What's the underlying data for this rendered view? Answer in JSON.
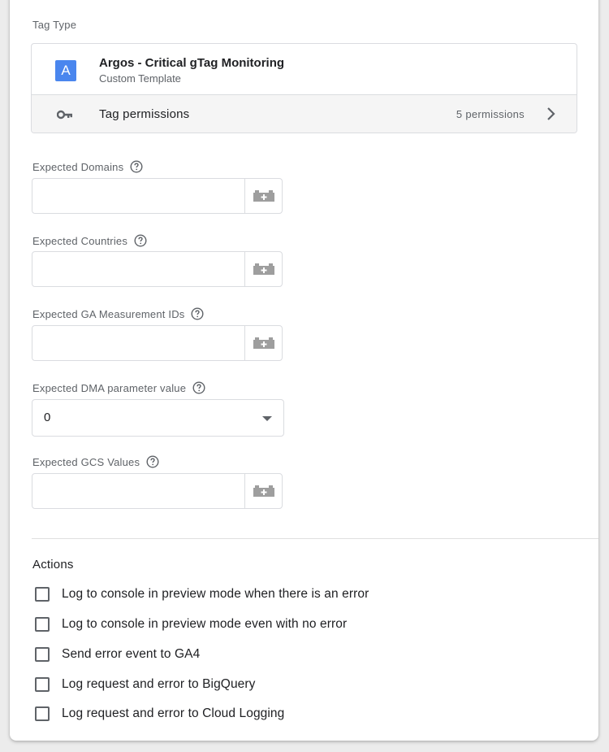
{
  "tag_type": {
    "section_label": "Tag Type",
    "avatar_letter": "A",
    "name": "Argos - Critical gTag Monitoring",
    "subtitle": "Custom Template",
    "permissions_label": "Tag permissions",
    "permissions_count": "5 permissions",
    "accent_color": "#4a86ee"
  },
  "fields": {
    "expected_domains": {
      "label": "Expected Domains",
      "value": ""
    },
    "expected_countries": {
      "label": "Expected Countries",
      "value": ""
    },
    "expected_ga_ids": {
      "label": "Expected GA Measurement IDs",
      "value": ""
    },
    "expected_dma": {
      "label": "Expected DMA parameter value",
      "selected": "0"
    },
    "expected_gcs": {
      "label": "Expected GCS Values",
      "value": ""
    }
  },
  "actions": {
    "title": "Actions",
    "items": [
      {
        "label": "Log to console in preview mode when there is an error",
        "checked": false
      },
      {
        "label": "Log to console in preview mode even with no error",
        "checked": false
      },
      {
        "label": "Send error event to GA4",
        "checked": false
      },
      {
        "label": "Log request and error to BigQuery",
        "checked": false
      },
      {
        "label": "Log request and error to Cloud Logging",
        "checked": false
      }
    ]
  },
  "icons": {
    "avatar": "letter-avatar",
    "permissions": "key-icon",
    "chevron": "chevron-right-icon",
    "help": "help-circle-icon",
    "variable": "variable-brick-icon",
    "dropdown": "caret-down-icon"
  }
}
